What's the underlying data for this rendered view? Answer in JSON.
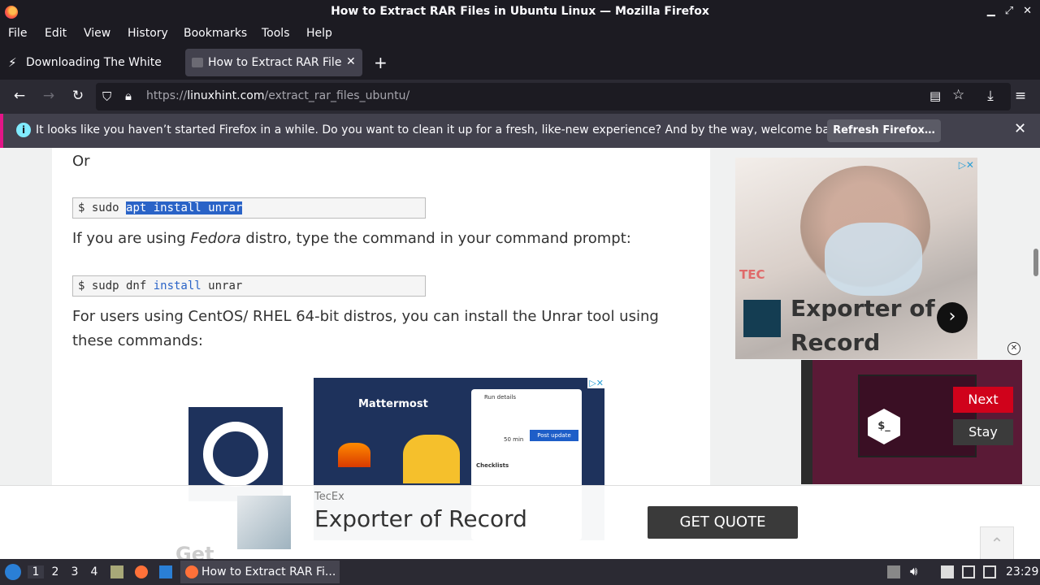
{
  "window": {
    "title": "How to Extract RAR Files in Ubuntu Linux — Mozilla Firefox",
    "controls": [
      "▁",
      "⤢",
      "✕"
    ]
  },
  "menu": [
    "File",
    "Edit",
    "View",
    "History",
    "Bookmarks",
    "Tools",
    "Help"
  ],
  "tabs": [
    {
      "label": "Downloading The White",
      "active": false
    },
    {
      "label": "How to Extract RAR Files",
      "active": true
    }
  ],
  "new_tab": "+",
  "nav": {
    "url_host": "linuxhint.com",
    "url_prefix": "https://",
    "url_path": "/extract_rar_files_ubuntu/"
  },
  "notification": {
    "message": "It looks like you haven’t started Firefox in a while. Do you want to clean it up for a fresh, like-new experience? And by the way, welcome back!",
    "button": "Refresh Firefox…"
  },
  "article": {
    "or": "Or",
    "cmd1_prefix": "$ sudo ",
    "cmd1_selected": "apt install unrar",
    "fedora_pre": "If you are using ",
    "fedora_em": "Fedora",
    "fedora_post": " distro, type the command in your command prompt:",
    "cmd2_a": "$ sudp dnf ",
    "cmd2_kw": "install",
    "cmd2_b": " unrar",
    "centos": "For users using CentOS/ RHEL 64-bit distros, you can install the Unrar tool using these commands:"
  },
  "right_ad": {
    "tec": "TEC",
    "headline_1": "Exporter of",
    "headline_2": "Record",
    "arrow": "›"
  },
  "video": {
    "next": "Next",
    "stay": "Stay",
    "shell": "$_"
  },
  "inline_ad": {
    "brand": "Mattermost",
    "card_title": "Run details",
    "card_btn": "Post update",
    "card_checklists": "Checklists",
    "card_time": "50 min"
  },
  "bottom_ad": {
    "advertiser": "TecEx",
    "headline": "Exporter of Record",
    "cta": "GET QUOTE",
    "ghost": "Get"
  },
  "taskbar": {
    "workspaces": [
      "1",
      "2",
      "3",
      "4"
    ],
    "task_label": "How to Extract RAR Fi...",
    "clock": "23:29"
  }
}
